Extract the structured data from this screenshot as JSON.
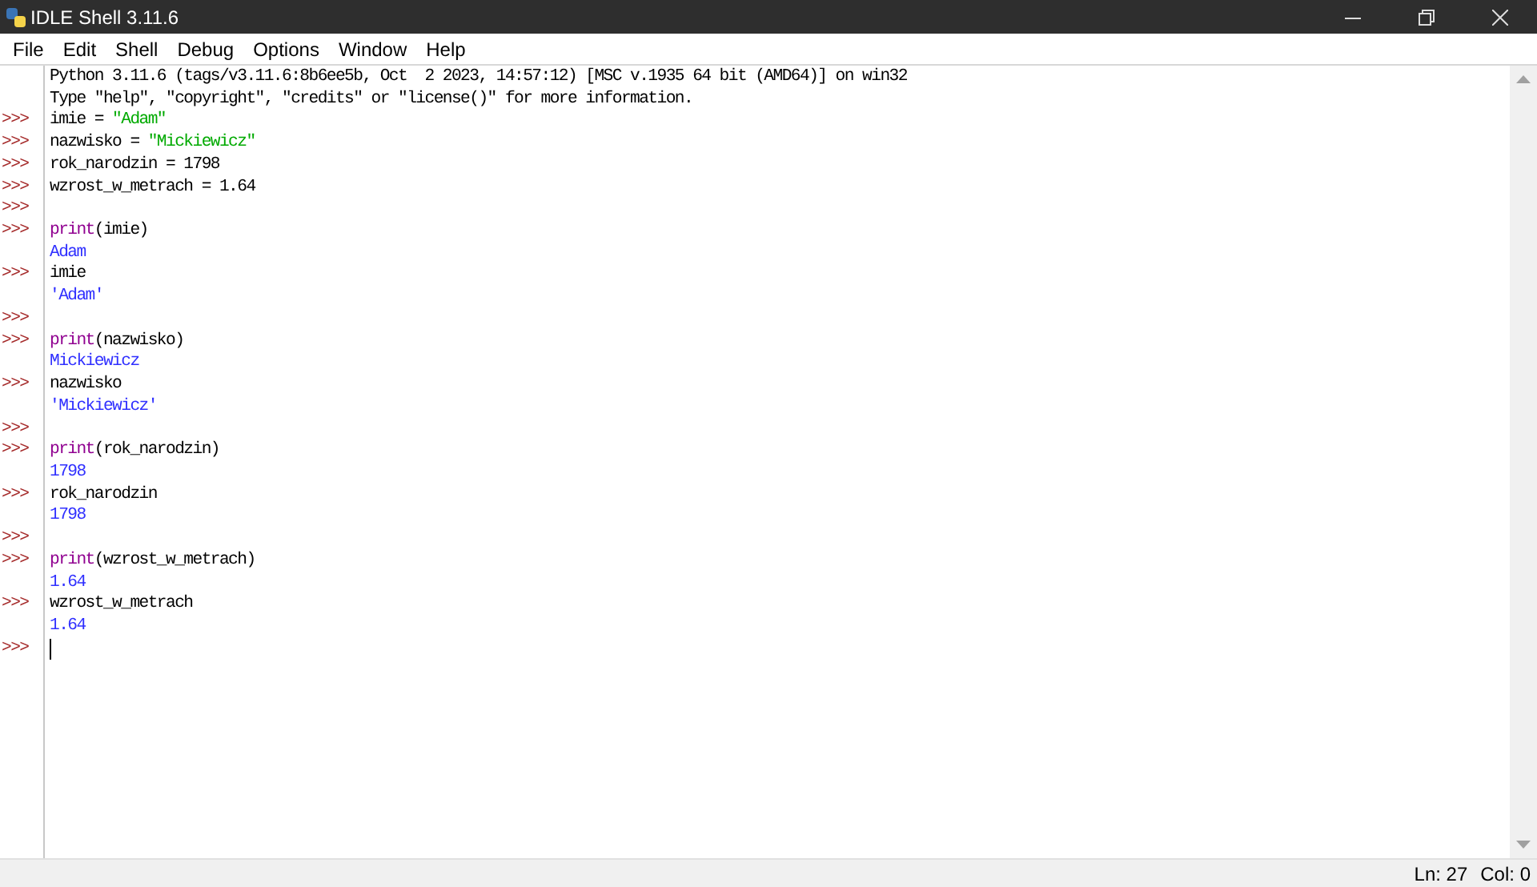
{
  "window": {
    "title": "IDLE Shell 3.11.6"
  },
  "menu": [
    "File",
    "Edit",
    "Shell",
    "Debug",
    "Options",
    "Window",
    "Help"
  ],
  "lines": [
    {
      "segments": [
        {
          "text": "Python 3.11.6 (tags/v3.11.6:8b6ee5b, Oct  2 2023, 14:57:12) [MSC v.1935 64 bit (AMD64)] on win32",
          "kind": "plain"
        }
      ]
    },
    {
      "segments": [
        {
          "text": "Type \"help\", \"copyright\", \"credits\" or \"license()\" for more information.",
          "kind": "plain"
        }
      ]
    },
    {
      "prompt": ">>>",
      "segments": [
        {
          "text": "imie = ",
          "kind": "plain"
        },
        {
          "text": "\"Adam\"",
          "kind": "string"
        }
      ]
    },
    {
      "prompt": ">>>",
      "segments": [
        {
          "text": "nazwisko = ",
          "kind": "plain"
        },
        {
          "text": "\"Mickiewicz\"",
          "kind": "string"
        }
      ]
    },
    {
      "prompt": ">>>",
      "segments": [
        {
          "text": "rok_narodzin = 1798",
          "kind": "plain"
        }
      ]
    },
    {
      "prompt": ">>>",
      "segments": [
        {
          "text": "wzrost_w_metrach = 1.64",
          "kind": "plain"
        }
      ]
    },
    {
      "prompt": ">>>"
    },
    {
      "prompt": ">>>",
      "segments": [
        {
          "text": "print",
          "kind": "builtin"
        },
        {
          "text": "(imie)",
          "kind": "plain"
        }
      ]
    },
    {
      "segments": [
        {
          "text": "Adam",
          "kind": "output"
        }
      ]
    },
    {
      "prompt": ">>>",
      "segments": [
        {
          "text": "imie",
          "kind": "plain"
        }
      ]
    },
    {
      "segments": [
        {
          "text": "'Adam'",
          "kind": "output"
        }
      ]
    },
    {
      "prompt": ">>>"
    },
    {
      "prompt": ">>>",
      "segments": [
        {
          "text": "print",
          "kind": "builtin"
        },
        {
          "text": "(nazwisko)",
          "kind": "plain"
        }
      ]
    },
    {
      "segments": [
        {
          "text": "Mickiewicz",
          "kind": "output"
        }
      ]
    },
    {
      "prompt": ">>>",
      "segments": [
        {
          "text": "nazwisko",
          "kind": "plain"
        }
      ]
    },
    {
      "segments": [
        {
          "text": "'Mickiewicz'",
          "kind": "output"
        }
      ]
    },
    {
      "prompt": ">>>"
    },
    {
      "prompt": ">>>",
      "segments": [
        {
          "text": "print",
          "kind": "builtin"
        },
        {
          "text": "(rok_narodzin)",
          "kind": "plain"
        }
      ]
    },
    {
      "segments": [
        {
          "text": "1798",
          "kind": "output"
        }
      ]
    },
    {
      "prompt": ">>>",
      "segments": [
        {
          "text": "rok_narodzin",
          "kind": "plain"
        }
      ]
    },
    {
      "segments": [
        {
          "text": "1798",
          "kind": "output"
        }
      ]
    },
    {
      "prompt": ">>>"
    },
    {
      "prompt": ">>>",
      "segments": [
        {
          "text": "print",
          "kind": "builtin"
        },
        {
          "text": "(wzrost_w_metrach)",
          "kind": "plain"
        }
      ]
    },
    {
      "segments": [
        {
          "text": "1.64",
          "kind": "output"
        }
      ]
    },
    {
      "prompt": ">>>",
      "segments": [
        {
          "text": "wzrost_w_metrach",
          "kind": "plain"
        }
      ]
    },
    {
      "segments": [
        {
          "text": "1.64",
          "kind": "output"
        }
      ]
    },
    {
      "prompt": ">>>",
      "cursor": true
    }
  ],
  "status_bar": {
    "line": "Ln: 27",
    "column": "Col: 0"
  }
}
